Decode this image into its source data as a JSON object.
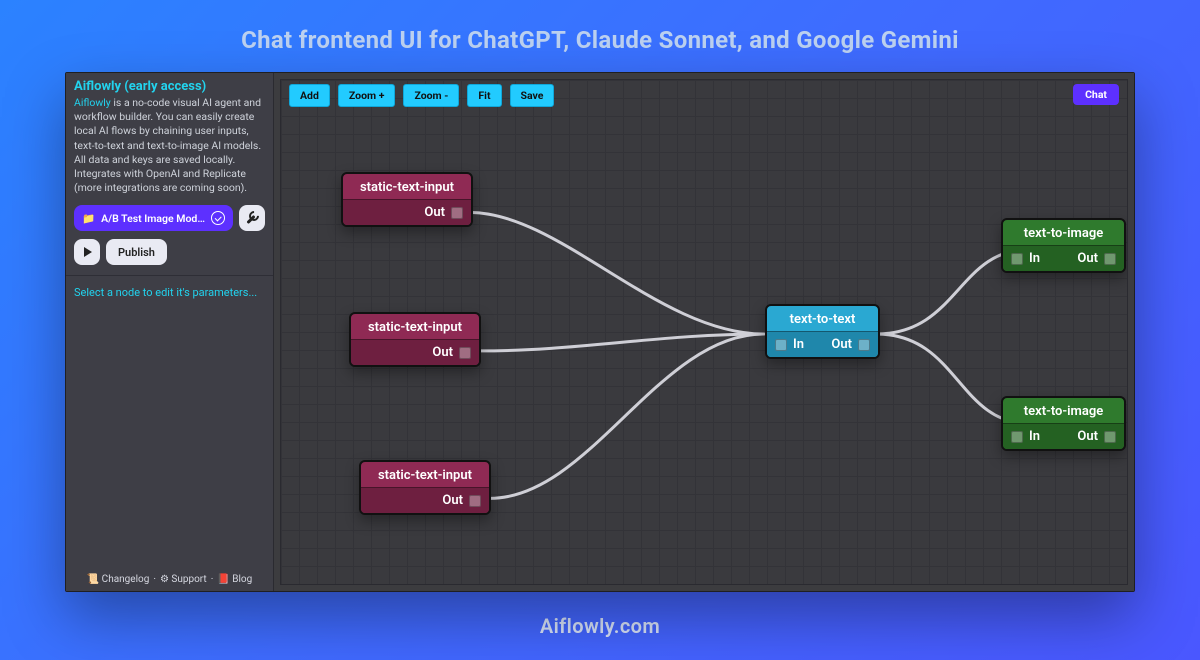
{
  "page": {
    "title": "Chat frontend UI for ChatGPT, Claude Sonnet, and Google Gemini",
    "footer": "Aiflowly.com"
  },
  "sidebar": {
    "brand": "Aiflowly (early access)",
    "brand_inline": "Aiflowly",
    "description_rest": " is a no-code visual AI agent and workflow builder. You can easily create local AI flows by chaining user inputs, text-to-text and text-to-image AI models. All data and keys are saved locally. Integrates with OpenAI and Replicate (more integrations are coming soon).",
    "pill_label": "A/B Test Image Model...",
    "publish_label": "Publish",
    "hint": "Select a node to edit it's parameters...",
    "footer_changelog": "📜 Changelog",
    "footer_support": "⚙ Support",
    "footer_blog": "📕 Blog",
    "footer_sep": " · "
  },
  "toolbar": {
    "add": "Add",
    "zoom_in": "Zoom +",
    "zoom_out": "Zoom -",
    "fit": "Fit",
    "save": "Save",
    "chat": "Chat"
  },
  "ports": {
    "in": "In",
    "out": "Out"
  },
  "nodes": {
    "n1": {
      "title": "static-text-input"
    },
    "n2": {
      "title": "static-text-input"
    },
    "n3": {
      "title": "static-text-input"
    },
    "n4": {
      "title": "text-to-text"
    },
    "n5": {
      "title": "text-to-image"
    },
    "n6": {
      "title": "text-to-image"
    }
  }
}
